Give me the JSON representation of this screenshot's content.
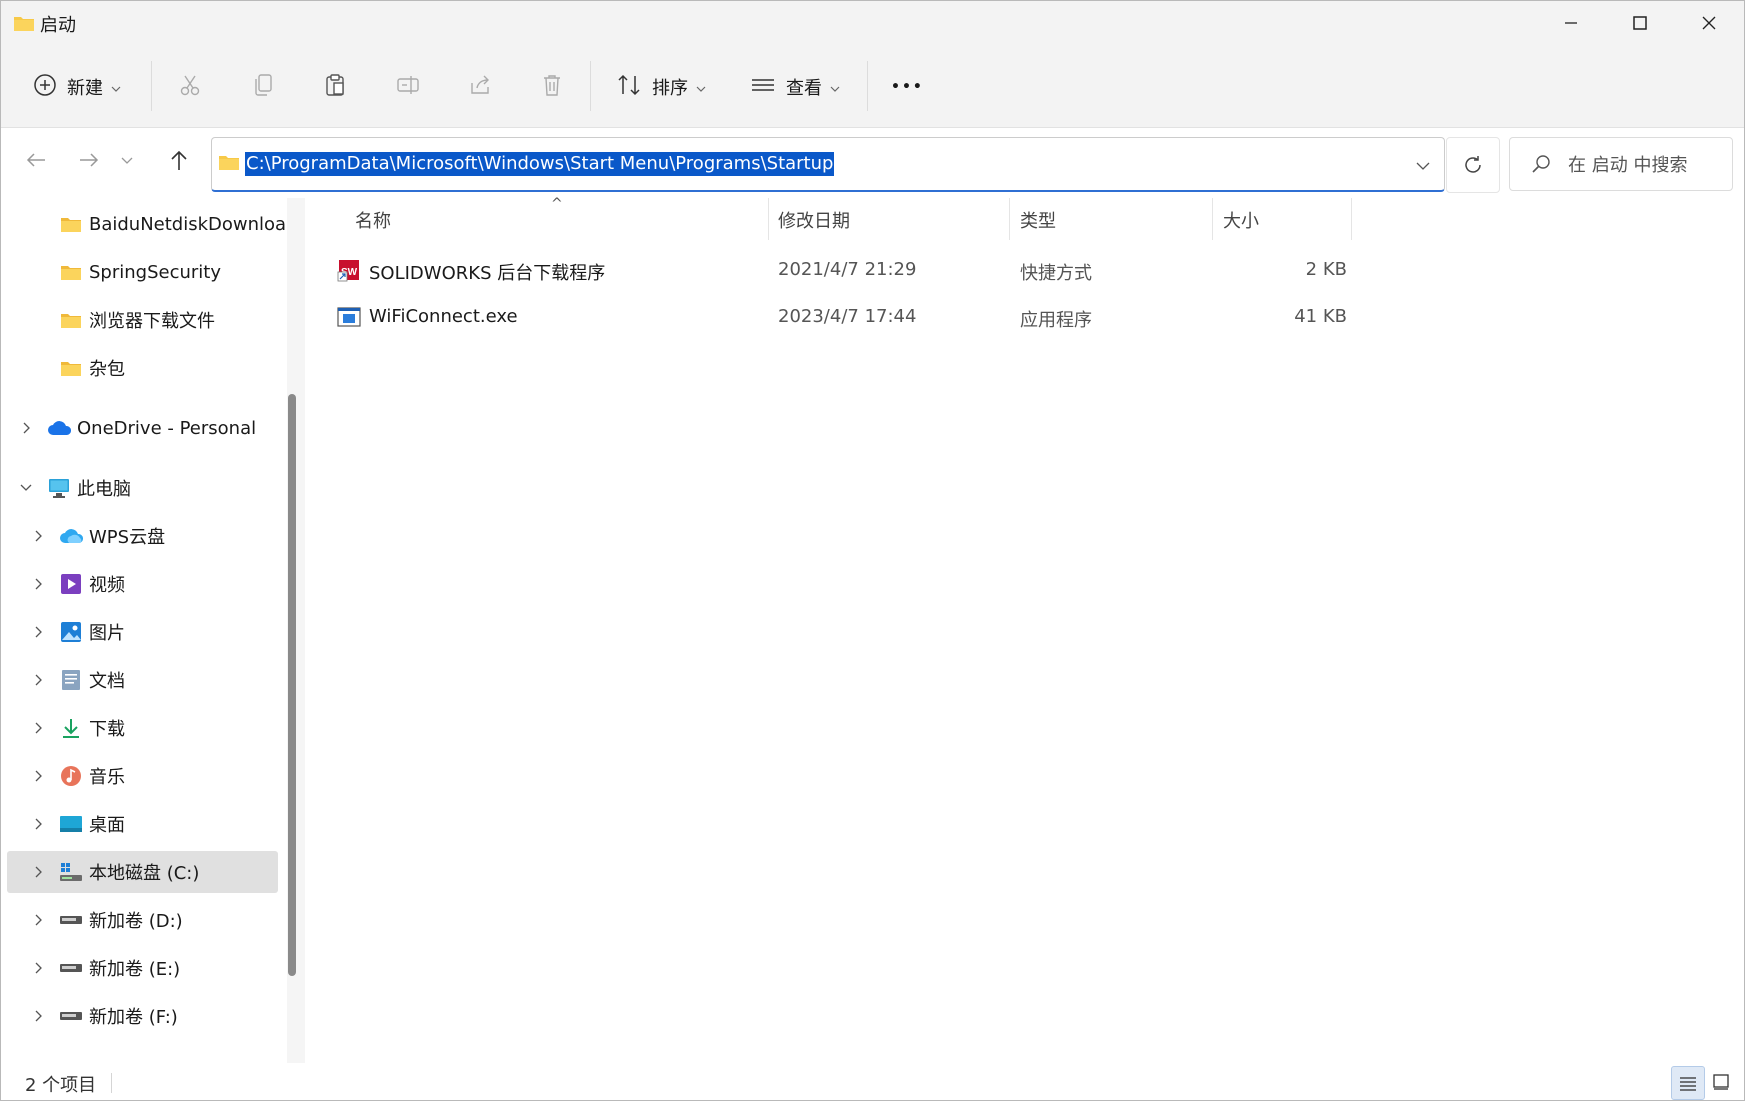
{
  "window": {
    "title": "启动",
    "minimize_glyph": "—",
    "maximize_glyph": "☐",
    "close_glyph": "✕"
  },
  "toolbar": {
    "new_label": "新建",
    "sort_label": "排序",
    "view_label": "查看",
    "more_glyph": "•••",
    "icons": [
      "plus-circle-icon",
      "cut-icon",
      "copy-icon",
      "paste-icon",
      "rename-icon",
      "share-icon",
      "delete-icon",
      "sort-icon",
      "view-icon",
      "more-icon"
    ]
  },
  "address": {
    "path": "C:\\ProgramData\\Microsoft\\Windows\\Start Menu\\Programs\\Startup",
    "search_placeholder": "在 启动 中搜索"
  },
  "nav": {
    "items": [
      {
        "label": "BaiduNetdiskDownloa",
        "icon": "folder-icon"
      },
      {
        "label": "SpringSecurity",
        "icon": "folder-icon"
      },
      {
        "label": "浏览器下载文件",
        "icon": "folder-icon"
      },
      {
        "label": "杂包",
        "icon": "folder-icon"
      },
      {
        "label": "OneDrive - Personal",
        "icon": "onedrive-icon"
      },
      {
        "label": "此电脑",
        "icon": "this-pc-icon"
      },
      {
        "label": "WPS云盘",
        "icon": "wps-cloud-icon"
      },
      {
        "label": "视频",
        "icon": "videos-icon"
      },
      {
        "label": "图片",
        "icon": "pictures-icon"
      },
      {
        "label": "文档",
        "icon": "documents-icon"
      },
      {
        "label": "下载",
        "icon": "downloads-icon"
      },
      {
        "label": "音乐",
        "icon": "music-icon"
      },
      {
        "label": "桌面",
        "icon": "desktop-icon"
      },
      {
        "label": "本地磁盘 (C:)",
        "icon": "system-drive-icon"
      },
      {
        "label": "新加卷 (D:)",
        "icon": "drive-icon"
      },
      {
        "label": "新加卷 (E:)",
        "icon": "drive-icon"
      },
      {
        "label": "新加卷 (F:)",
        "icon": "drive-icon"
      }
    ]
  },
  "list": {
    "columns": [
      "名称",
      "修改日期",
      "类型",
      "大小"
    ],
    "sort_glyph": "^",
    "rows": [
      {
        "name": "SOLIDWORKS 后台下载程序",
        "date": "2021/4/7 21:29",
        "type": "快捷方式",
        "size": "2 KB",
        "icon": "solidworks-shortcut-icon"
      },
      {
        "name": "WiFiConnect.exe",
        "date": "2023/4/7 17:44",
        "type": "应用程序",
        "size": "41 KB",
        "icon": "exe-app-icon"
      }
    ]
  },
  "status": {
    "count": "2 个项目"
  }
}
